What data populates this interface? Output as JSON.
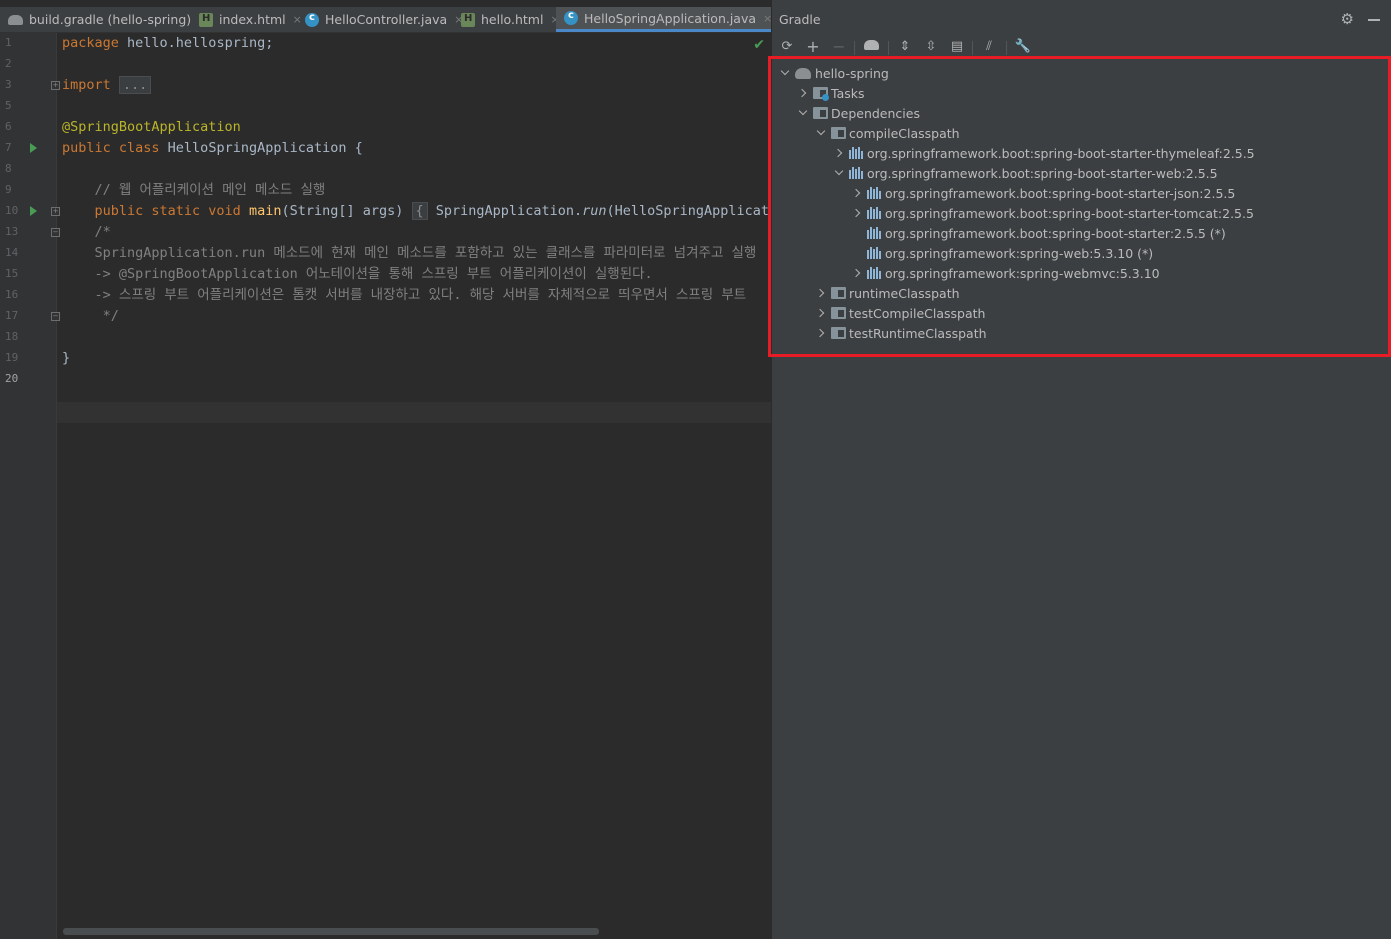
{
  "tabs": [
    {
      "label": "build.gradle (hello-spring)",
      "icon": "gradle-icon",
      "active": false
    },
    {
      "label": "index.html",
      "icon": "html-file-icon",
      "active": false
    },
    {
      "label": "HelloController.java",
      "icon": "java-class-icon",
      "active": false
    },
    {
      "label": "hello.html",
      "icon": "html-file-icon",
      "active": false
    },
    {
      "label": "HelloSpringApplication.java",
      "icon": "java-class-icon",
      "active": true
    }
  ],
  "tab_close": "×",
  "editor": {
    "line_numbers": [
      "1",
      "2",
      "3",
      "5",
      "6",
      "7",
      "8",
      "9",
      "10",
      "13",
      "14",
      "15",
      "16",
      "17",
      "18",
      "19",
      "20"
    ],
    "code": {
      "l1_kw": "package",
      "l1_rest": " hello.hellospring;",
      "l3_kw": "import",
      "l3_fold": "...",
      "l6_ann": "@SpringBootApplication",
      "l7_kw": "public class",
      "l7_rest": " HelloSpringApplication {",
      "l9_comment": "    // 웹 어플리케이션 메인 메소드 실행",
      "l10_kw": "    public static void",
      "l10_method": " main",
      "l10_args": "(String[] args)",
      "l10_fold": "{",
      "l10_rest1": " SpringApplication.",
      "l10_run": "run",
      "l10_rest2": "(HelloSpringApplication.class, args); }",
      "l13": "    /*",
      "l14": "    SpringApplication.run 메소드에 현재 메인 메소드를 포함하고 있는 클래스를 파라미터로 넘겨주고 실행",
      "l15": "    -> @SpringBootApplication 어노테이션을 통해 스프링 부트 어플리케이션이 실행된다.",
      "l16": "    -> 스프링 부트 어플리케이션은 톰캣 서버를 내장하고 있다. 해당 서버를 자체적으로 띄우면서 스프링 부트",
      "l17": "     */",
      "l19": "}"
    },
    "status_icon": "checkmark-icon"
  },
  "gradle": {
    "title": "Gradle",
    "toolbar_icons": [
      "reload-icon",
      "add-icon",
      "remove-icon",
      "execute-task-icon",
      "expand-all-icon",
      "collapse-all-icon",
      "dependencies-icon",
      "offline-toggle-icon",
      "settings-wrench-icon"
    ],
    "tree": {
      "root": "hello-spring",
      "tasks": "Tasks",
      "dependencies": "Dependencies",
      "compileClasspath": "compileClasspath",
      "dep_thymeleaf": "org.springframework.boot:spring-boot-starter-thymeleaf:2.5.5",
      "dep_web": "org.springframework.boot:spring-boot-starter-web:2.5.5",
      "dep_json": "org.springframework.boot:spring-boot-starter-json:2.5.5",
      "dep_tomcat": "org.springframework.boot:spring-boot-starter-tomcat:2.5.5",
      "dep_starter": "org.springframework.boot:spring-boot-starter:2.5.5 (*)",
      "dep_spring_web": "org.springframework:spring-web:5.3.10 (*)",
      "dep_webmvc": "org.springframework:spring-webmvc:5.3.10",
      "runtimeClasspath": "runtimeClasspath",
      "testCompileClasspath": "testCompileClasspath",
      "testRuntimeClasspath": "testRuntimeClasspath"
    },
    "highlight_color": "#e81c24"
  }
}
